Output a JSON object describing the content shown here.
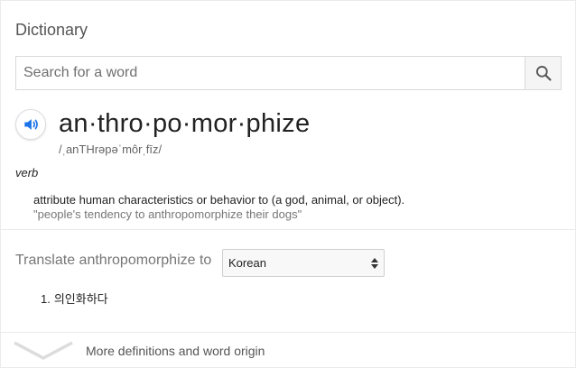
{
  "header": {
    "title": "Dictionary"
  },
  "search": {
    "placeholder": "Search for a word",
    "value": "",
    "icon": "search-icon"
  },
  "entry": {
    "headword": "an·thro·po·mor·phize",
    "pronunciation": "/ˌanTHrəpəˈmôrˌfīz/",
    "audio_icon": "speaker-icon",
    "part_of_speech": "verb",
    "definition": "attribute human characteristics or behavior to (a god, animal, or object).",
    "example": "\"people's tendency to anthropomorphize their dogs\""
  },
  "translate": {
    "label": "Translate anthropomorphize to",
    "selected_language": "Korean",
    "results": [
      {
        "num": "1.",
        "text": "의인화하다"
      }
    ]
  },
  "footer": {
    "more_label": "More definitions and word origin",
    "icon": "chevron-down-icon"
  },
  "colors": {
    "accent_blue": "#1a73e8",
    "text_primary": "#222222",
    "text_secondary": "#777777",
    "border": "#d9d9d9"
  }
}
